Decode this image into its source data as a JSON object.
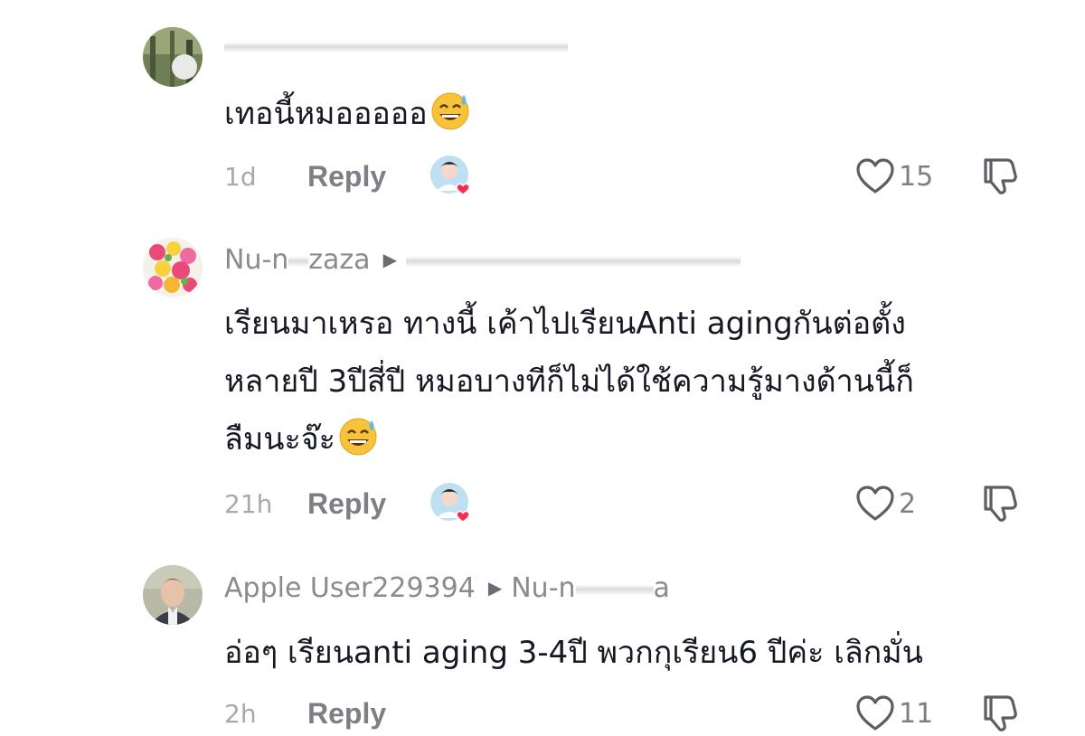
{
  "comments": [
    {
      "author": "",
      "reply_to": "",
      "text": "เทอนี้หมอออออ",
      "emoji": "grinning-sweat-emoji",
      "time": "1d",
      "reply_label": "Reply",
      "likes": "15",
      "liked_by_creator": true
    },
    {
      "author": "Nu-n",
      "author_tail": "zaza",
      "reply_to": "",
      "text_line1": "เรียนมาเหรอ ทางนี้ เค้าไปเรียนAnti agingกันต่อตั้ง",
      "text_line2": "หลายปี 3ปีสี่ปี หมอบางทีก็ไม่ได้ใช้ความรู้มางด้านนี้ก็",
      "text_line3": "ลืมนะจ๊ะ",
      "emoji": "grinning-sweat-emoji",
      "time": "21h",
      "reply_label": "Reply",
      "likes": "2",
      "liked_by_creator": true
    },
    {
      "author": "Apple User229394",
      "reply_to": "Nu-n",
      "reply_to_tail": "a",
      "text": "อ่อๆ เรียนanti aging 3-4ปี พวกกุเรียน6 ปีค่ะ เลิกมั่น",
      "time": "2h",
      "reply_label": "Reply",
      "likes": "11",
      "liked_by_creator": false
    }
  ],
  "colors": {
    "text": "#161823",
    "meta": "#8a8b91",
    "heart_red": "#fe2c55"
  }
}
